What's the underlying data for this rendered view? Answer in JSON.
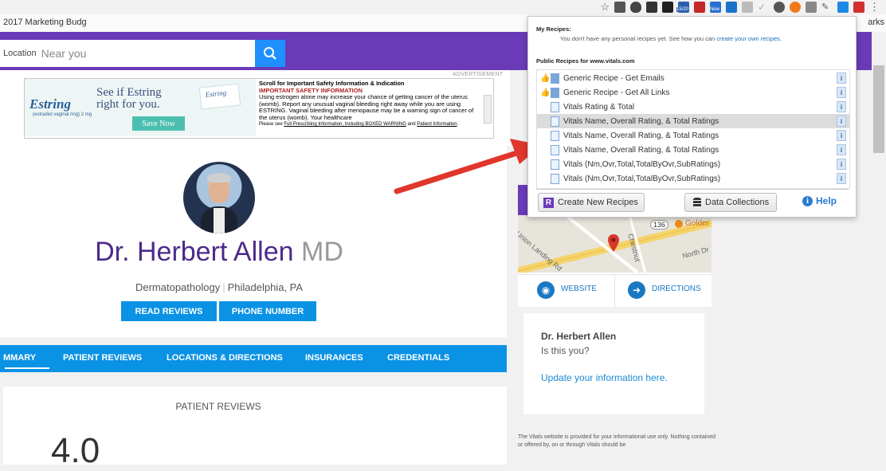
{
  "browser": {
    "bookmark_first": "2017 Marketing Budg",
    "bookmark_right": "arks",
    "extension_icons": [
      "star-icon",
      "m-icon",
      "pocket-icon",
      "layers-icon",
      "evernote-icon",
      "calendar-icon",
      "lastpass-icon",
      "new-icon",
      "trello-icon",
      "extension-icon",
      "check-icon",
      "opera-icon",
      "recipe-icon",
      "si-icon",
      "pen-icon",
      "screen-icon",
      "dataminer-icon",
      "menu-icon"
    ],
    "ext_badge": "15/20",
    "ext_new_badge": "New"
  },
  "header": {
    "location_label": "Location",
    "location_value": "Near you",
    "accent_color": "#6a3ab8"
  },
  "ad": {
    "label": "ADVERTISEMENT",
    "logo": "Estring",
    "logo_sub": "(estradiol vaginal ring) 2 mg",
    "headline_line1": "See if Estring",
    "headline_line2": "right for you.",
    "save_button": "Save Now",
    "box_text": "Estring",
    "title": "Scroll for Important Safety Information & Indication",
    "warning": "IMPORTANT SAFETY INFORMATION",
    "body": "Using estrogen alone may increase your chance of getting cancer of the uterus (womb). Report any unusual vaginal bleeding right away while you are using ESTRING. Vaginal bleeding after menopause may be a warning sign of cancer of the uterus (womb). Your healthcare",
    "foot_prefix": "Please see ",
    "foot_link1": "Full Prescribing Information, Including BOXED WARNING",
    "foot_mid": " and ",
    "foot_link2": "Patient Information",
    "foot_end": "."
  },
  "profile": {
    "name": "Dr. Herbert Allen",
    "suffix": "MD",
    "specialty": "Dermatopathology",
    "location": "Philadelphia, PA",
    "read_reviews": "READ REVIEWS",
    "phone_number": "PHONE NUMBER"
  },
  "tabs": [
    "MMARY",
    "PATIENT REVIEWS",
    "LOCATIONS & DIRECTIONS",
    "INSURANCES",
    "CREDENTIALS"
  ],
  "reviews": {
    "title": "PATIENT REVIEWS",
    "rating": "4.0"
  },
  "map": {
    "road_badge": "136",
    "place": "Golder",
    "street1": "Union Landing Rd",
    "street2": "Chestnut",
    "street3": "North Dr",
    "website": "WEBSITE",
    "directions": "DIRECTIONS"
  },
  "claim": {
    "name": "Dr. Herbert Allen",
    "question": "Is this you?",
    "link": "Update your information here."
  },
  "disclaimer": "The Vitals website is provided for your informational use only. Nothing contained or offered by, on or through Vitals should be",
  "popup": {
    "my_recipes": "My Recipes:",
    "my_msg": "You don't have any personal recipes yet. See how you can ",
    "my_link": "create your own recipes.",
    "public_title": "Public Recipes for www.vitals.com",
    "recipes": [
      {
        "label": "Generic Recipe - Get Emails",
        "thumb": true,
        "filled": true,
        "selected": false
      },
      {
        "label": "Generic Recipe - Get All Links",
        "thumb": true,
        "filled": true,
        "selected": false
      },
      {
        "label": "Vitals Rating & Total",
        "thumb": false,
        "filled": false,
        "selected": false
      },
      {
        "label": "Vitals Name, Overall Rating, & Total Ratings",
        "thumb": false,
        "filled": false,
        "selected": true
      },
      {
        "label": "Vitals Name, Overall Rating, & Total Ratings",
        "thumb": false,
        "filled": false,
        "selected": false
      },
      {
        "label": "Vitals Name, Overall Rating, & Total Ratings",
        "thumb": false,
        "filled": false,
        "selected": false
      },
      {
        "label": "Vitals (Nm,Ovr,Total,TotalByOvr,SubRatings)",
        "thumb": false,
        "filled": false,
        "selected": false
      },
      {
        "label": "Vitals (Nm,Ovr,Total,TotalByOvr,SubRatings)",
        "thumb": false,
        "filled": false,
        "selected": false
      }
    ],
    "create_btn": "Create New Recipes",
    "data_btn": "Data Collections",
    "help": "Help"
  }
}
